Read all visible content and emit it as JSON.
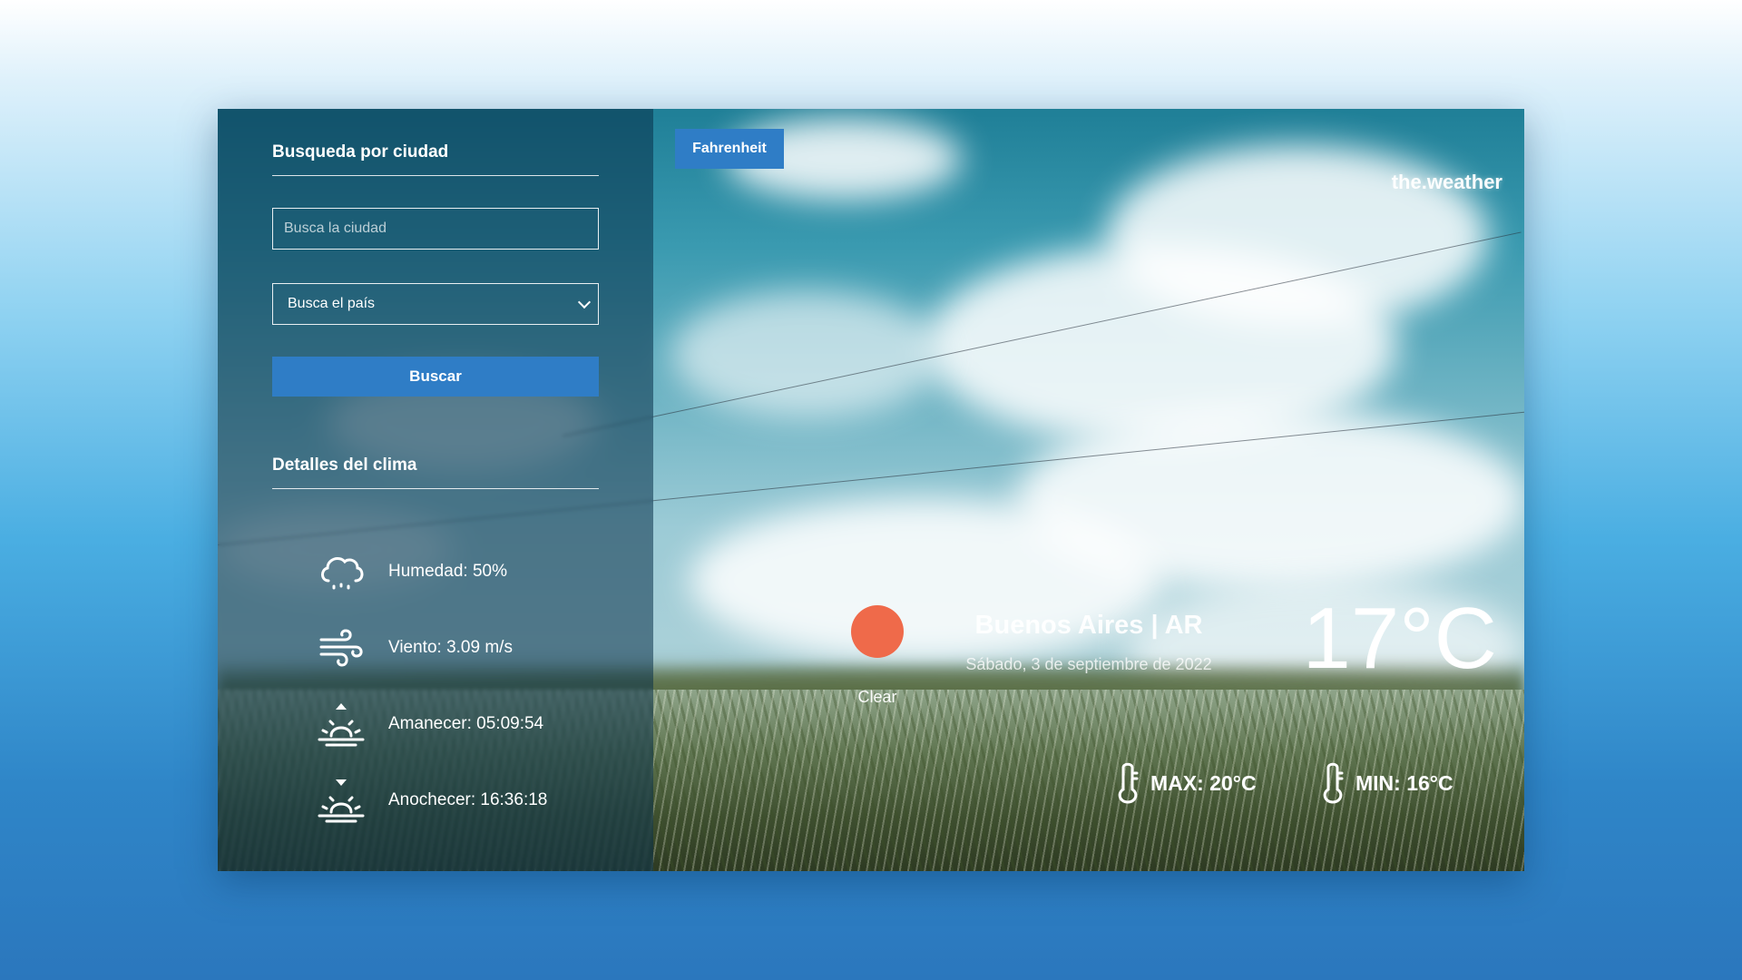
{
  "search": {
    "section_title": "Busqueda por ciudad",
    "city_placeholder": "Busca la ciudad",
    "city_value": "",
    "country_selected": "Busca el país",
    "button_label": "Buscar"
  },
  "details": {
    "section_title": "Detalles del clima",
    "items": [
      {
        "label": "Humedad: 50%",
        "icon": "cloud-icon"
      },
      {
        "label": "Viento: 3.09 m/s",
        "icon": "wind-icon"
      },
      {
        "label": "Amanecer: 05:09:54",
        "icon": "sunrise-icon"
      },
      {
        "label": "Anochecer: 16:36:18",
        "icon": "sunset-icon"
      }
    ]
  },
  "main": {
    "unit_toggle_label": "Fahrenheit",
    "brand": "the.weather",
    "condition": "Clear",
    "condition_icon": "sun-icon",
    "location": "Buenos Aires | AR",
    "date": "Sábado, 3 de septiembre de 2022",
    "temperature": "17°C",
    "max": "MAX: 20°C",
    "min": "MIN: 16°C"
  },
  "colors": {
    "accent": "#2f7dc6",
    "sun": "#ef6a4a"
  }
}
